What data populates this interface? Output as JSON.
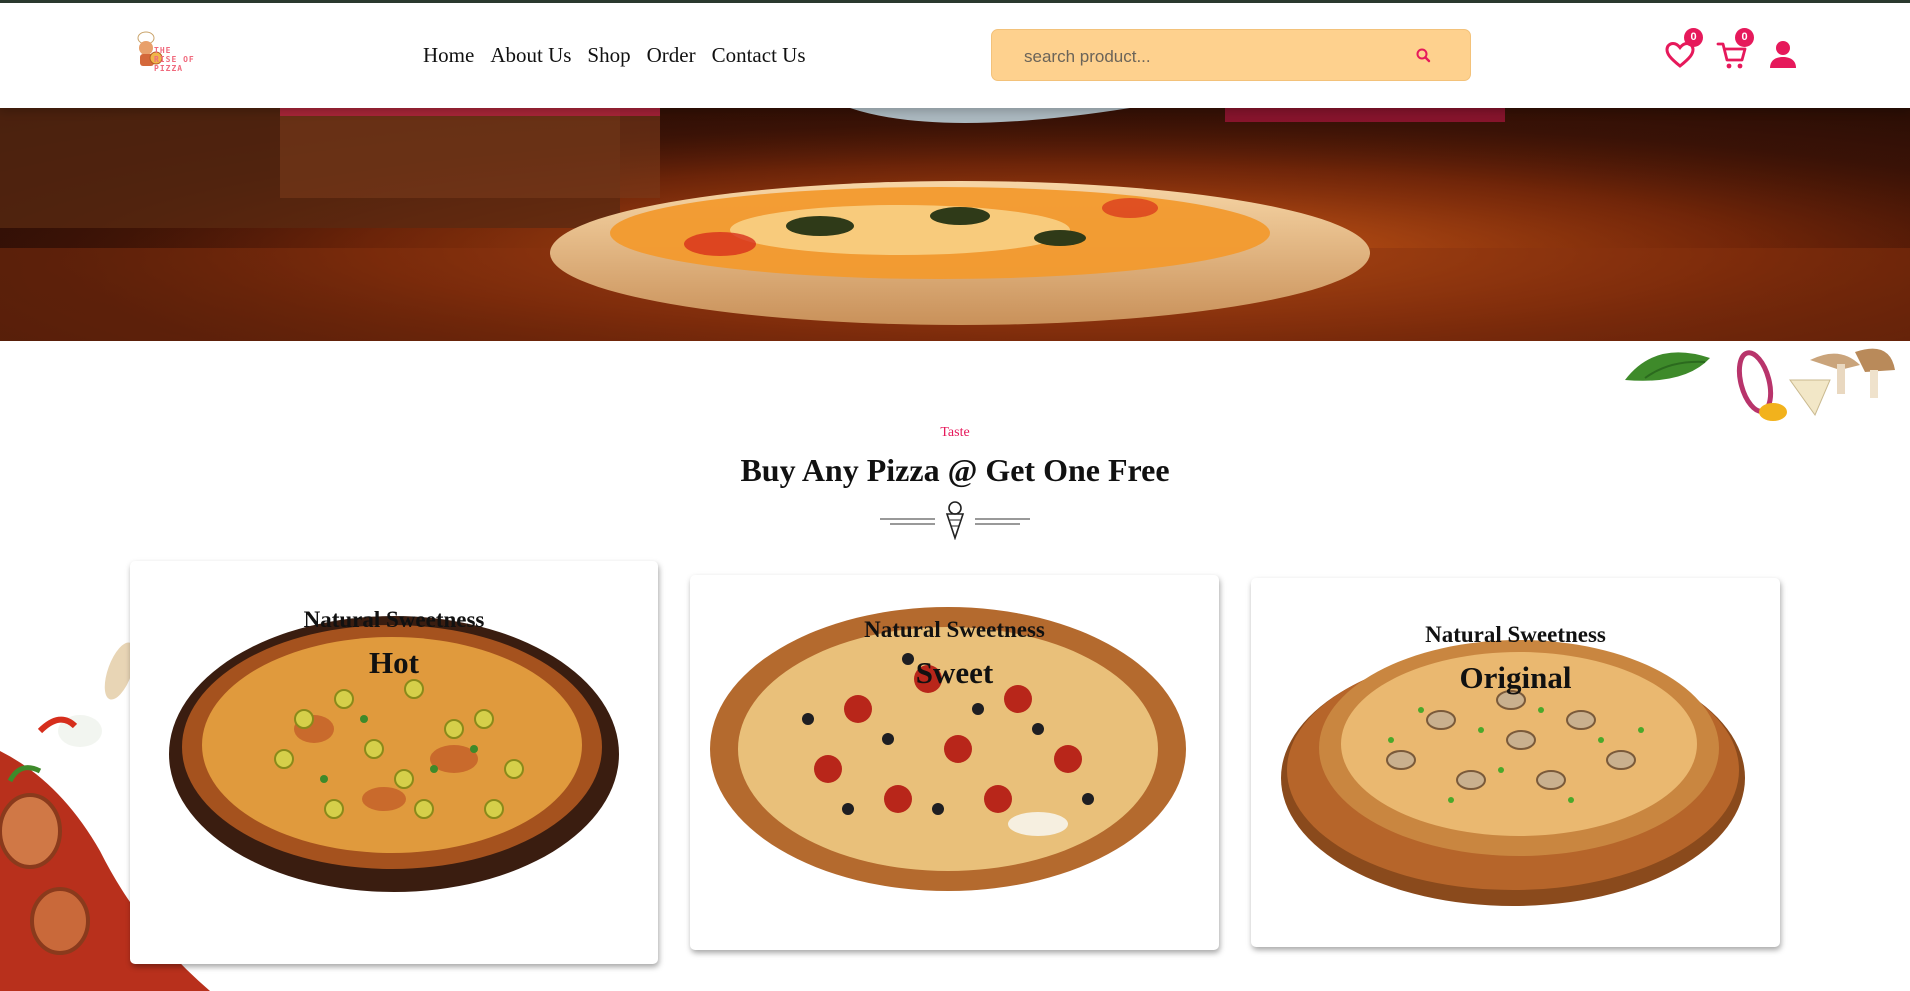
{
  "brand": {
    "logo_line1": "THE",
    "logo_line2": "RISE OF PIZZA"
  },
  "nav": {
    "items": [
      "Home",
      "About Us",
      "Shop",
      "Order",
      "Contact Us"
    ]
  },
  "search": {
    "placeholder": "search product..."
  },
  "header_icons": {
    "wishlist_count": "0",
    "cart_count": "0",
    "icons": [
      "heart-icon",
      "cart-icon",
      "user-icon"
    ]
  },
  "section": {
    "eyebrow": "Taste",
    "title": "Buy Any Pizza @ Get One Free",
    "divider_icon": "ice-cream-cone-icon"
  },
  "cards": [
    {
      "subtitle": "Natural Sweetness",
      "title": "Hot"
    },
    {
      "subtitle": "Natural Sweetness",
      "title": "Sweet"
    },
    {
      "subtitle": "Natural Sweetness",
      "title": "Original"
    }
  ],
  "colors": {
    "accent": "#e6195b",
    "search_bg": "#fed18e",
    "top_border": "#2b3a2f"
  }
}
